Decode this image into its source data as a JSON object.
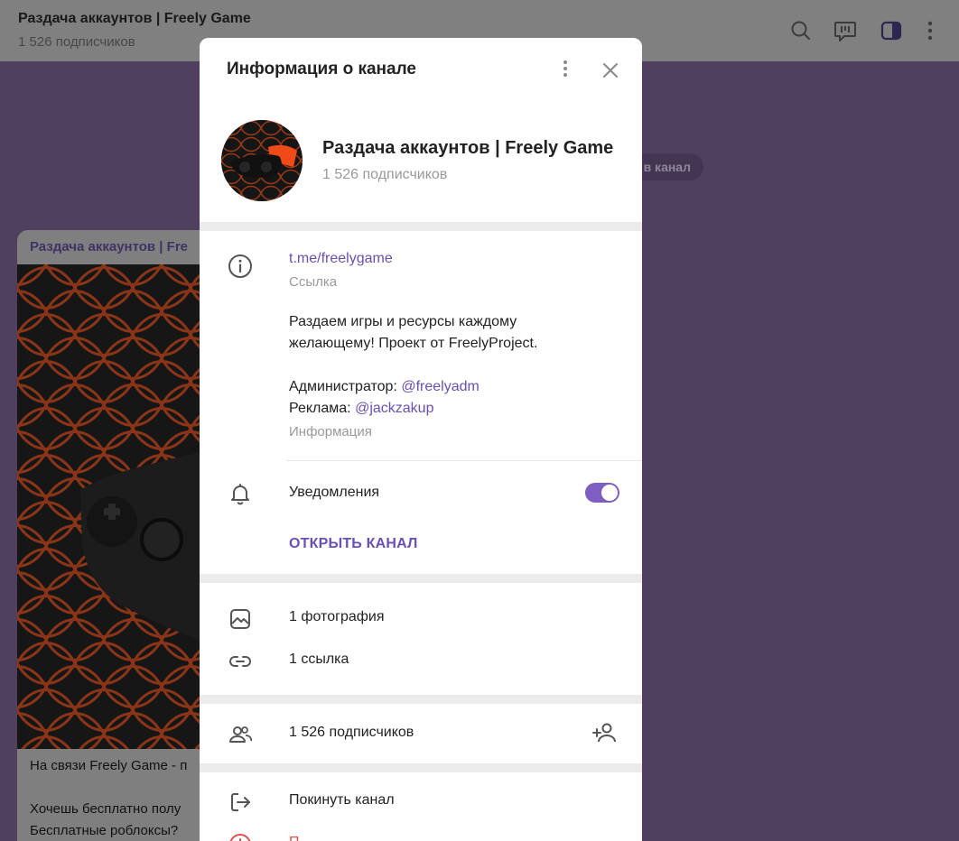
{
  "header": {
    "title": "Раздача аккаунтов | Freely Game",
    "subtitle": "1 526 подписчиков",
    "icons": [
      "search-icon",
      "comments-icon",
      "sidebar-panel-icon",
      "more-vertical-icon"
    ]
  },
  "chat": {
    "date_pill": "в канал",
    "message": {
      "author": "Раздача аккаунтов | Fre",
      "text": "На связи Freely Game - п\n\nХочешь бесплатно полу\nБесплатные роблоксы?\nБ                        М"
    }
  },
  "modal": {
    "title": "Информация о канале",
    "channel_name": "Раздача аккаунтов | Freely Game",
    "channel_subscribers": "1 526 подписчиков",
    "link": {
      "value": "t.me/freelygame",
      "label": "Ссылка"
    },
    "description": {
      "line1": "Раздаем игры и ресурсы каждому",
      "line2": "желающему! Проект от FreelyProject.",
      "admin_prefix": "Администратор: ",
      "admin_handle": "@freelyadm",
      "ads_prefix": "Реклама: ",
      "ads_handle": "@jackzakup",
      "label": "Информация"
    },
    "notifications": {
      "label": "Уведомления",
      "enabled": true
    },
    "open_channel": "ОТКРЫТЬ КАНАЛ",
    "media": {
      "photos": "1 фотография",
      "links": "1 ссылка"
    },
    "members": {
      "count": "1 526 подписчиков"
    },
    "leave": "Покинуть канал",
    "report": "П"
  },
  "colors": {
    "accent": "#6a4fb4",
    "toggle": "#7e5fc1",
    "chat_background": "#504060",
    "danger": "#e05050"
  }
}
